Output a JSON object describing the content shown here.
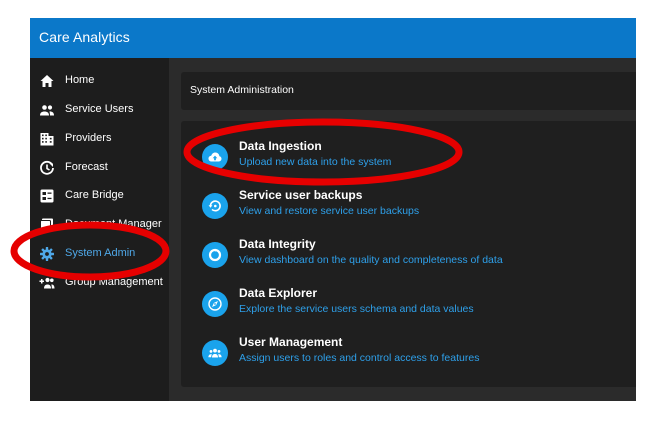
{
  "app": {
    "title": "Care Analytics"
  },
  "sidebar": {
    "items": [
      {
        "label": "Home",
        "icon": "home-icon"
      },
      {
        "label": "Service Users",
        "icon": "people-icon"
      },
      {
        "label": "Providers",
        "icon": "building-icon"
      },
      {
        "label": "Forecast",
        "icon": "forecast-icon"
      },
      {
        "label": "Care Bridge",
        "icon": "bridge-icon"
      },
      {
        "label": "Document Manager",
        "icon": "document-icon"
      },
      {
        "label": "System Admin",
        "icon": "gear-icon",
        "active": true
      },
      {
        "label": "Group Management",
        "icon": "group-add-icon"
      }
    ]
  },
  "main": {
    "header": {
      "title": "System Administration"
    },
    "items": [
      {
        "title": "Data Ingestion",
        "subtitle": "Upload new data into the system",
        "icon": "cloud-upload-icon"
      },
      {
        "title": "Service user backups",
        "subtitle": "View and restore service user backups",
        "icon": "backup-restore-icon"
      },
      {
        "title": "Data Integrity",
        "subtitle": "View dashboard on the quality and completeness of data",
        "icon": "integrity-icon"
      },
      {
        "title": "Data Explorer",
        "subtitle": "Explore the service users schema and data values",
        "icon": "compass-icon"
      },
      {
        "title": "User Management",
        "subtitle": "Assign users to roles and control access to features",
        "icon": "user-group-icon"
      }
    ]
  },
  "colors": {
    "topbar": "#0b78c9",
    "accent": "#1aa3ec",
    "annotation": "#e60000"
  }
}
